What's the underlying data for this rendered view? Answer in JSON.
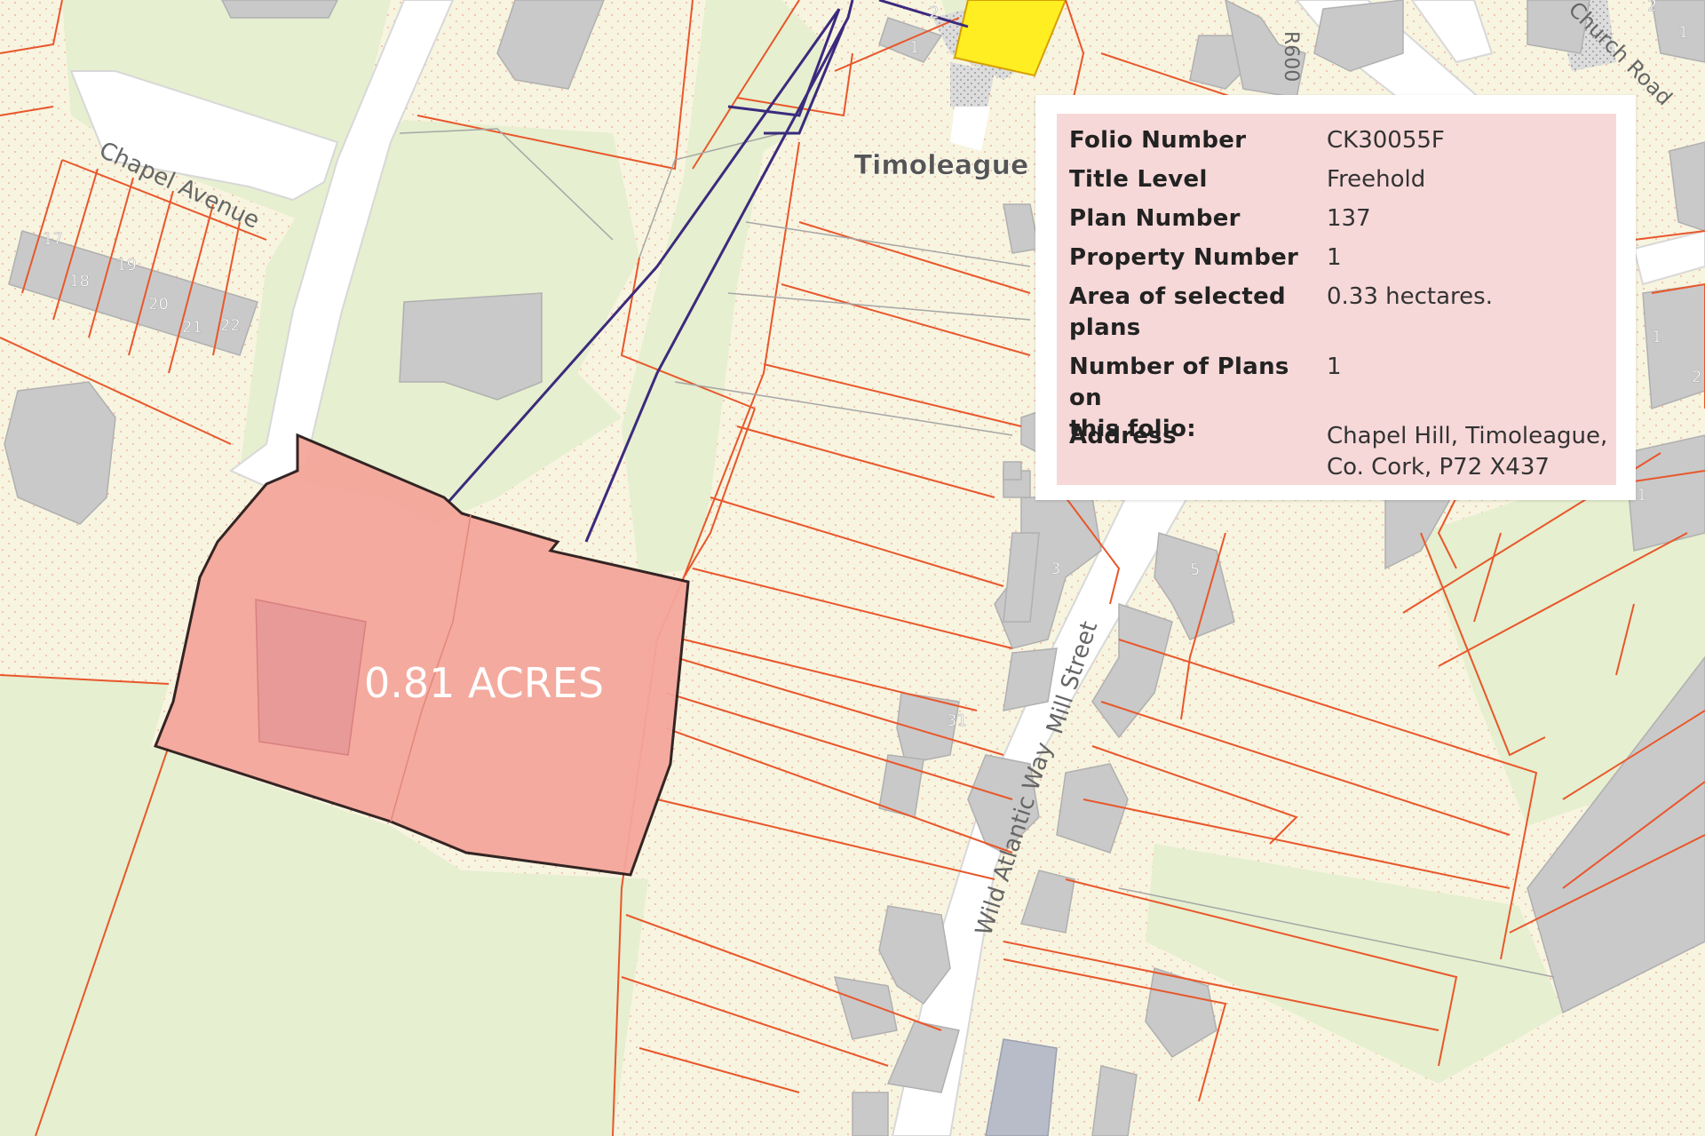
{
  "map": {
    "parcel_label": "0.81 ACRES",
    "place_name": "Timoleague",
    "streets": {
      "chapel_avenue": "Chapel Avenue",
      "church_road": "Church Road",
      "r600": "R600",
      "mill_street": "Mill Street",
      "wild_atlantic_way": "Wild Atlantic Way"
    },
    "house_numbers": {
      "n17": "17",
      "n18": "18",
      "n19": "19",
      "n20": "20",
      "n21": "21",
      "n22": "22",
      "n1a": "1",
      "n2a": "2",
      "n3": "3",
      "n5": "5",
      "n31": "31",
      "n1b": "1",
      "n1c": "1",
      "n1d": "1",
      "n2b": "2",
      "n2c": "2"
    },
    "colors": {
      "background": "#f7f4e0",
      "green_area": "#e6efcf",
      "road": "#ffffff",
      "building": "#c9c9c9",
      "boundary": "#e8572b",
      "selected_parcel_fill": "#f4a79b",
      "selected_parcel_outline": "#2a1a1a",
      "route_line": "#3b2a7e",
      "yellow_parcel": "#ffee22"
    }
  },
  "folio": {
    "rows": [
      {
        "label": "Folio Number",
        "value": "CK30055F"
      },
      {
        "label": "Title Level",
        "value": "Freehold"
      },
      {
        "label": "Plan Number",
        "value": "137"
      },
      {
        "label": "Property Number",
        "value": "1"
      },
      {
        "label_line1": "Area of selected",
        "label_line2": "plans",
        "value": "0.33 hectares."
      },
      {
        "label_line1": "Number of Plans on",
        "label_line2": "this folio:",
        "value": "1"
      },
      {
        "label": "Address",
        "value_line1": "Chapel Hill, Timoleague,",
        "value_line2": "Co. Cork, P72 X437"
      }
    ]
  }
}
